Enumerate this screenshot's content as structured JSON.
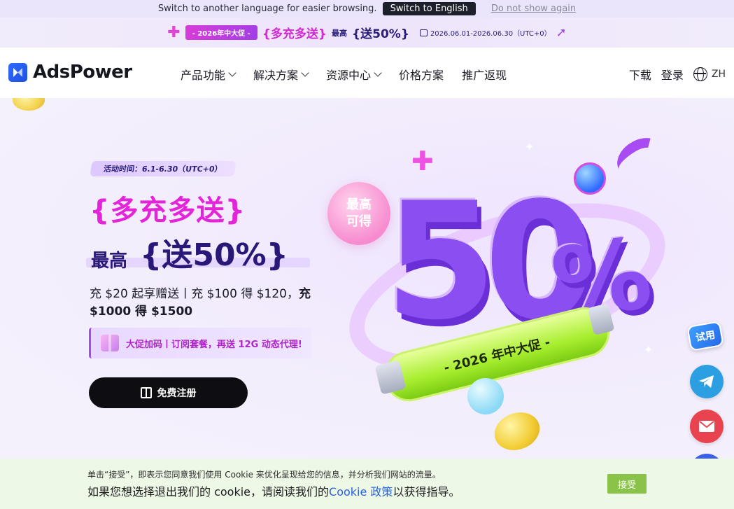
{
  "lang_bar": {
    "message": "Switch to another language for easier browsing.",
    "switch_label": "Switch to English",
    "dismiss_label": "Do not show again"
  },
  "promo_strip": {
    "pill": "- 2026年中大促 -",
    "title": "{多充多送}",
    "max_label": "最高",
    "bonus": "{送50%}",
    "date_range": "2026.06.01-2026.06.30（UTC+0）"
  },
  "header": {
    "brand": "AdsPower",
    "nav": [
      {
        "label": "产品功能",
        "has_dropdown": true
      },
      {
        "label": "解决方案",
        "has_dropdown": true
      },
      {
        "label": "资源中心",
        "has_dropdown": true
      },
      {
        "label": "价格方案",
        "has_dropdown": false
      },
      {
        "label": "推广返现",
        "has_dropdown": false
      }
    ],
    "download": "下载",
    "login": "登录",
    "language": "ZH"
  },
  "hero": {
    "event_time": "活动时间：6.1-6.30（UTC+0）",
    "headline": "{多充多送}",
    "max_label": "最高",
    "headline_bonus": "{送50%}",
    "desc_part1": "充 $20 起享赠送丨充 $100 得 $120，",
    "desc_part2": "充 $1000 得 $1500",
    "gift_text": "大促加码丨订阅套餐，再送 12G 动态代理!",
    "cta_label": "免费注册",
    "art": {
      "bubble_line1": "最高",
      "bubble_line2": "可得",
      "big_number": "50",
      "percent": "%",
      "tube_text": "- 2026 年中大促 -"
    }
  },
  "floating": {
    "try_label": "试用"
  },
  "cookie": {
    "line1": "单击“接受”，即表示您同意我们使用 Cookie 来优化呈现给您的信息，并分析我们网站的流量。",
    "line2_before": "如果您想选择退出我们的 cookie，请阅读我们的",
    "line2_link": "Cookie 政策",
    "line2_after": "以获得指导。",
    "accept_label": "接受"
  },
  "colors": {
    "brand_blue": "#2f6bff",
    "accent_magenta": "#e324d8",
    "accent_purple": "#2a1878",
    "cookie_accept": "#8bc34a"
  }
}
